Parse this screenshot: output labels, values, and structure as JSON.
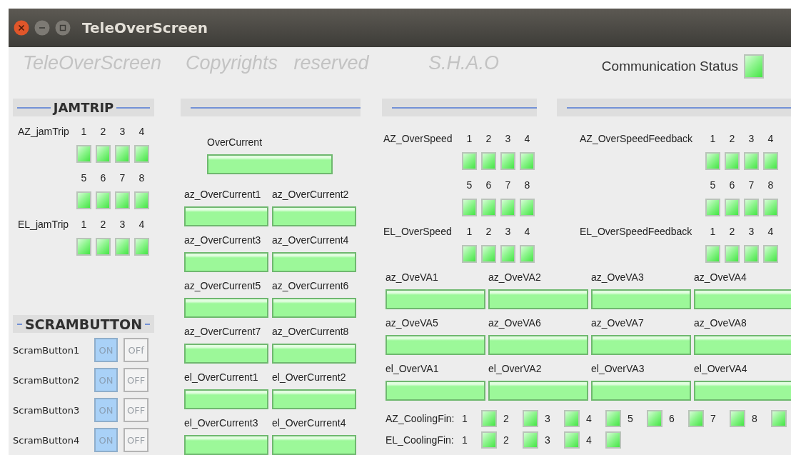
{
  "window": {
    "title": "TeleOverScreen"
  },
  "banner": {
    "app_name": "TeleOverScreen",
    "copyright": "Copyrights   reserved",
    "organization": "S.H.A.O",
    "communication_status": {
      "label": "Communication Status",
      "on": true
    }
  },
  "jamtrip": {
    "title": "JAMTRIP",
    "groups": [
      {
        "label": "AZ_jamTrip",
        "channels": [
          {
            "number": "1",
            "on": true
          },
          {
            "number": "2",
            "on": true
          },
          {
            "number": "3",
            "on": true
          },
          {
            "number": "4",
            "on": true
          },
          {
            "number": "5",
            "on": true
          },
          {
            "number": "6",
            "on": true
          },
          {
            "number": "7",
            "on": true
          },
          {
            "number": "8",
            "on": true
          }
        ]
      },
      {
        "label": "EL_jamTrip",
        "channels": [
          {
            "number": "1",
            "on": true
          },
          {
            "number": "2",
            "on": true
          },
          {
            "number": "3",
            "on": true
          },
          {
            "number": "4",
            "on": true
          }
        ]
      }
    ]
  },
  "scram": {
    "title": "SCRAMBUTTON",
    "rows": [
      {
        "label": "ScramButton1",
        "options": [
          {
            "text": "ON",
            "selected": true
          },
          {
            "text": "OFf",
            "selected": false
          }
        ]
      },
      {
        "label": "ScramButton2",
        "options": [
          {
            "text": "ON",
            "selected": true
          },
          {
            "text": "OFF",
            "selected": false
          }
        ]
      },
      {
        "label": "ScramButton3",
        "options": [
          {
            "text": "ON",
            "selected": true
          },
          {
            "text": "OFF",
            "selected": false
          }
        ]
      },
      {
        "label": "ScramButton4",
        "options": [
          {
            "text": "ON",
            "selected": true
          },
          {
            "text": "OFF",
            "selected": false
          }
        ]
      }
    ]
  },
  "overcurrent": {
    "main": [
      {
        "label": "OverCurrent",
        "on": true
      }
    ],
    "channels": [
      {
        "label": "az_OverCurrent1",
        "on": true
      },
      {
        "label": "az_OverCurrent2",
        "on": true
      },
      {
        "label": "az_OverCurrent3",
        "on": true
      },
      {
        "label": "az_OverCurrent4",
        "on": true
      },
      {
        "label": "az_OverCurrent5",
        "on": true
      },
      {
        "label": "az_OverCurrent6",
        "on": true
      },
      {
        "label": "az_OverCurrent7",
        "on": true
      },
      {
        "label": "az_OverCurrent8",
        "on": true
      },
      {
        "label": "el_OverCurrent1",
        "on": true
      },
      {
        "label": "el_OverCurrent2",
        "on": true
      },
      {
        "label": "el_OverCurrent3",
        "on": true
      },
      {
        "label": "el_OverCurrent4",
        "on": true
      }
    ]
  },
  "overspeed": {
    "groups": [
      {
        "label": "AZ_OverSpeed",
        "channels": [
          {
            "number": "1",
            "on": true
          },
          {
            "number": "2",
            "on": true
          },
          {
            "number": "3",
            "on": true
          },
          {
            "number": "4",
            "on": true
          },
          {
            "number": "5",
            "on": true
          },
          {
            "number": "6",
            "on": true
          },
          {
            "number": "7",
            "on": true
          },
          {
            "number": "8",
            "on": true
          }
        ]
      },
      {
        "label": "EL_OverSpeed",
        "channels": [
          {
            "number": "1",
            "on": true
          },
          {
            "number": "2",
            "on": true
          },
          {
            "number": "3",
            "on": true
          },
          {
            "number": "4",
            "on": true
          }
        ]
      }
    ]
  },
  "overspeed_feedback": {
    "groups": [
      {
        "label": "AZ_OverSpeedFeedback",
        "channels": [
          {
            "number": "1",
            "on": true
          },
          {
            "number": "2",
            "on": true
          },
          {
            "number": "3",
            "on": true
          },
          {
            "number": "4",
            "on": true
          },
          {
            "number": "5",
            "on": true
          },
          {
            "number": "6",
            "on": true
          },
          {
            "number": "7",
            "on": true
          },
          {
            "number": "8",
            "on": true
          }
        ]
      },
      {
        "label": "EL_OverSpeedFeedback",
        "channels": [
          {
            "number": "1",
            "on": true
          },
          {
            "number": "2",
            "on": true
          },
          {
            "number": "3",
            "on": true
          },
          {
            "number": "4",
            "on": true
          }
        ]
      }
    ]
  },
  "voltage": {
    "channels": [
      {
        "label": "az_OveVA1",
        "on": true
      },
      {
        "label": "az_OveVA2",
        "on": true
      },
      {
        "label": "az_OveVA3",
        "on": true
      },
      {
        "label": "az_OveVA4",
        "on": true
      },
      {
        "label": "az_OveVA5",
        "on": true
      },
      {
        "label": "az_OveVA6",
        "on": true
      },
      {
        "label": "az_OveVA7",
        "on": true
      },
      {
        "label": "az_OveVA8",
        "on": true
      },
      {
        "label": "el_OverVA1",
        "on": true
      },
      {
        "label": "el_OverVA2",
        "on": true
      },
      {
        "label": "el_OverVA3",
        "on": true
      },
      {
        "label": "el_OverVA4",
        "on": true
      }
    ]
  },
  "cooling_fins": [
    {
      "label": "AZ_CoolingFin:",
      "channels": [
        {
          "number": "1",
          "on": true
        },
        {
          "number": "2",
          "on": true
        },
        {
          "number": "3",
          "on": true
        },
        {
          "number": "4",
          "on": true
        },
        {
          "number": "5",
          "on": true
        },
        {
          "number": "6",
          "on": true
        },
        {
          "number": "7",
          "on": true
        },
        {
          "number": "8",
          "on": true
        }
      ]
    },
    {
      "label": "EL_CoolingFin:",
      "channels": [
        {
          "number": "1",
          "on": true
        },
        {
          "number": "2",
          "on": true
        },
        {
          "number": "3",
          "on": true
        },
        {
          "number": "4",
          "on": true
        }
      ]
    }
  ]
}
